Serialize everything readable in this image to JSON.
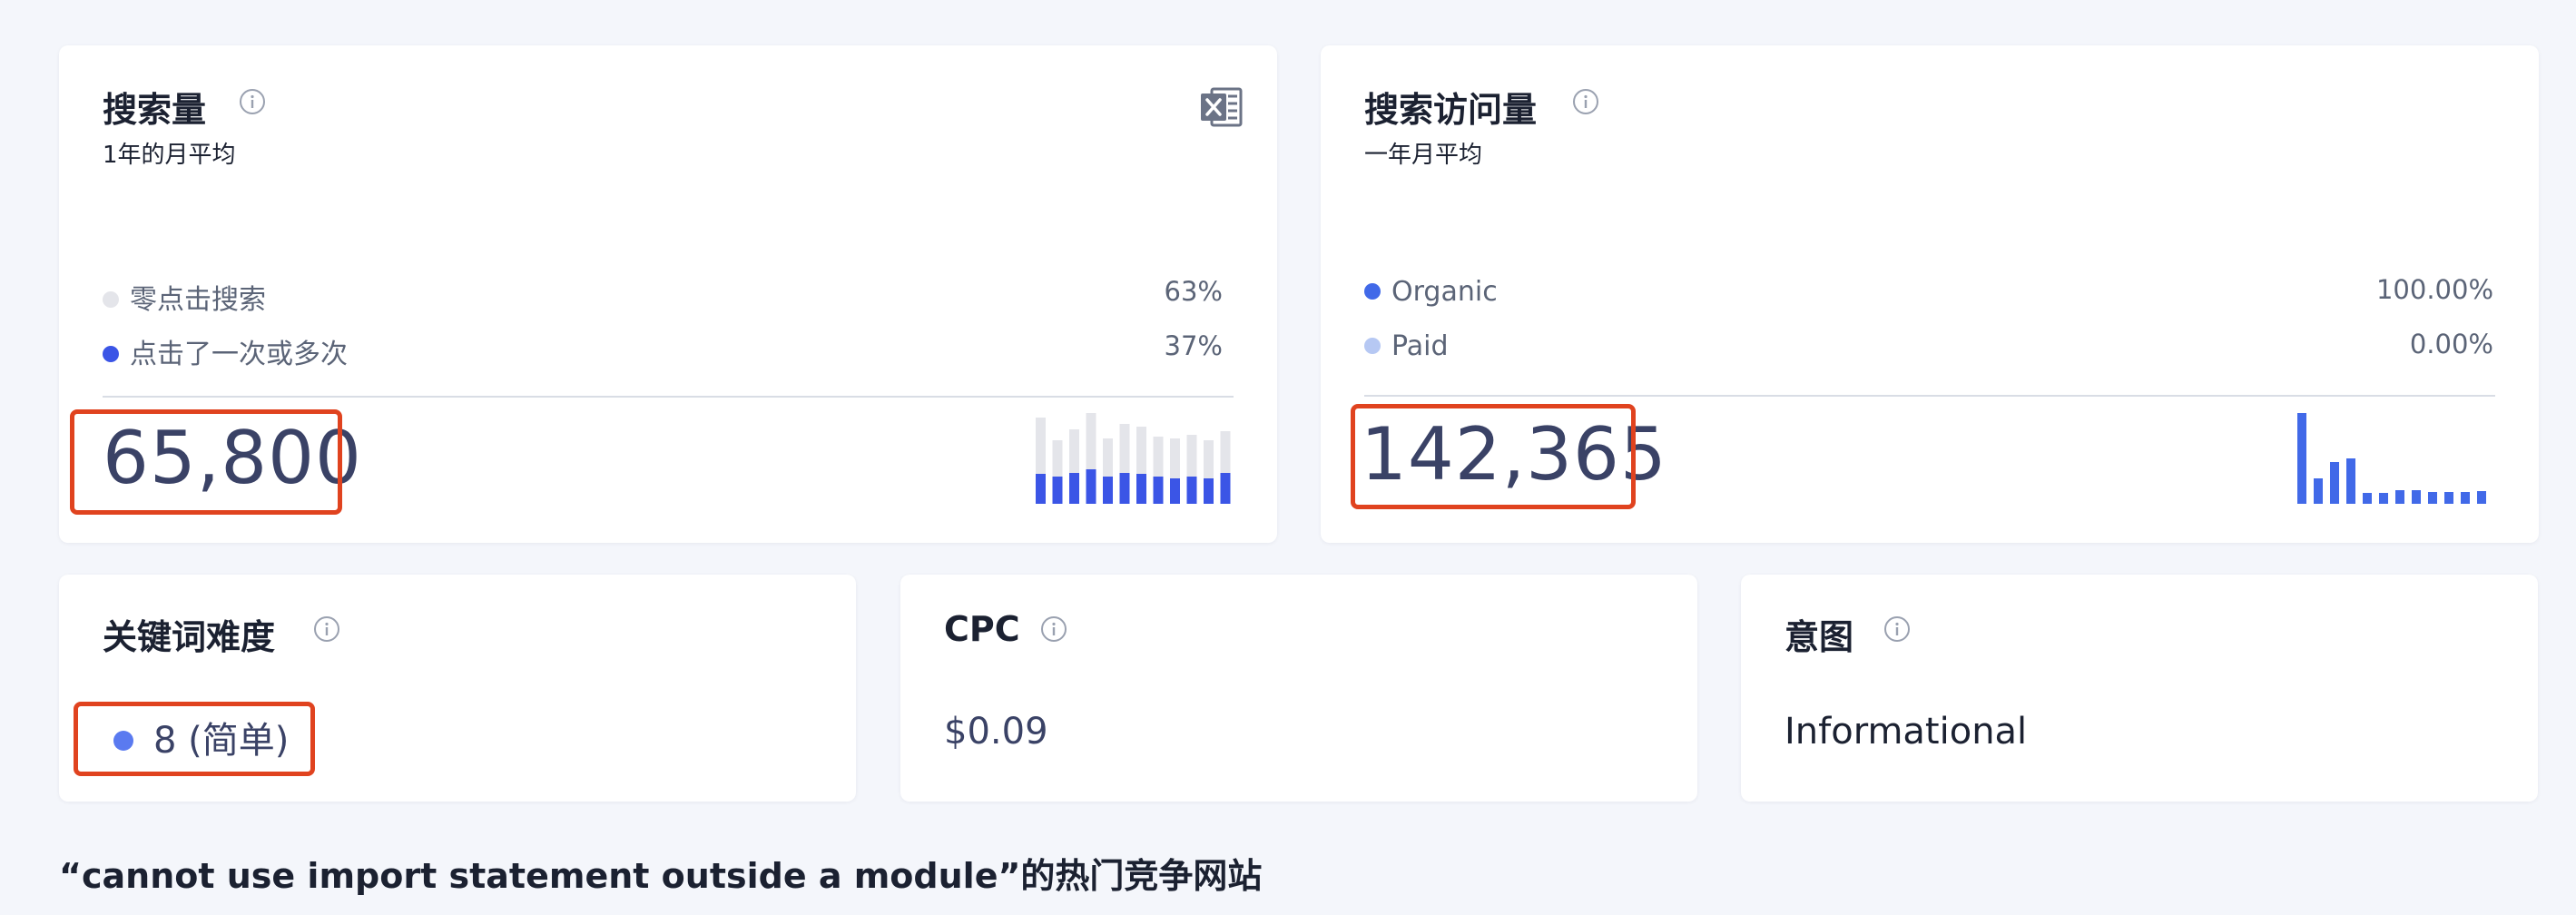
{
  "search_volume": {
    "title": "搜索量",
    "subtitle": "1年的月平均",
    "value": "65,800",
    "legend": [
      {
        "label": "零点击搜索",
        "percent": "63%",
        "color": "#e4e5ea"
      },
      {
        "label": "点击了一次或多次",
        "percent": "37%",
        "color": "#3b55e6"
      }
    ],
    "excel_icon": "excel-export-icon",
    "sparkline": {
      "total": [
        0.95,
        0.7,
        0.82,
        1.0,
        0.72,
        0.88,
        0.85,
        0.74,
        0.72,
        0.76,
        0.7,
        0.8
      ],
      "clicked": [
        0.33,
        0.3,
        0.34,
        0.38,
        0.3,
        0.34,
        0.33,
        0.3,
        0.28,
        0.3,
        0.28,
        0.34
      ],
      "total_color": "#e4e5ea",
      "clicked_color": "#3b55e6"
    }
  },
  "search_traffic": {
    "title": "搜索访问量",
    "subtitle": "一年月平均",
    "value": "142,365",
    "legend": [
      {
        "label": "Organic",
        "percent": "100.00%",
        "color": "#4169e8"
      },
      {
        "label": "Paid",
        "percent": "0.00%",
        "color": "#b6c8f3"
      }
    ],
    "sparkline": {
      "values": [
        1.0,
        0.28,
        0.46,
        0.5,
        0.12,
        0.12,
        0.15,
        0.15,
        0.13,
        0.13,
        0.13,
        0.14
      ],
      "color": "#4169e8"
    }
  },
  "keyword_difficulty": {
    "title": "关键词难度",
    "value": "8 (简单)",
    "dot_color": "#5a7af0"
  },
  "cpc": {
    "title": "CPC",
    "value": "$0.09"
  },
  "intent": {
    "title": "意图",
    "value": "Informational"
  },
  "competitors_heading": "“cannot use import statement outside a module”的热门竞争网站",
  "colors": {
    "highlight": "#e0431f",
    "background": "#f4f6fb",
    "number": "#3a4266"
  }
}
